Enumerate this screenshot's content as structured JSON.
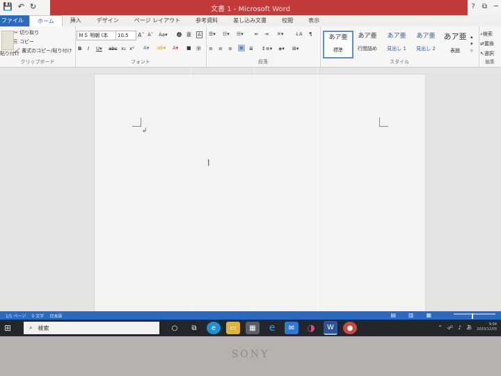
{
  "window": {
    "title": "文書 1 - Microsoft Word",
    "help": "?",
    "controls": [
      "⧉",
      "─"
    ]
  },
  "quick_access": [
    "💾",
    "↶",
    "↻"
  ],
  "tabs": [
    {
      "label": "ファイル"
    },
    {
      "label": "ホーム"
    },
    {
      "label": "挿入"
    },
    {
      "label": "デザイン"
    },
    {
      "label": "ページ レイアウト"
    },
    {
      "label": "参考資料"
    },
    {
      "label": "差し込み文書"
    },
    {
      "label": "校閲"
    },
    {
      "label": "表示"
    }
  ],
  "ribbon": {
    "clipboard": {
      "paste": "貼り付け",
      "cut": "切り取り",
      "copy": "コピー",
      "format_painter": "書式のコピー/貼り付け",
      "label": "クリップボード"
    },
    "font": {
      "name": "ＭＳ 明朝 (本",
      "size": "10.5",
      "label": "フォント"
    },
    "paragraph": {
      "label": "段落"
    },
    "styles": {
      "items": [
        {
          "preview": "あア亜",
          "name": "標準"
        },
        {
          "preview": "あア亜",
          "name": "行間詰め"
        },
        {
          "preview": "あア亜",
          "name": "見出し 1"
        },
        {
          "preview": "あア亜",
          "name": "見出し 2"
        },
        {
          "preview": "あア亜",
          "name": "表題"
        }
      ],
      "label": "スタイル"
    },
    "editing": {
      "find": "検索",
      "replace": "置換",
      "select": "選択",
      "label": "編集"
    }
  },
  "status": {
    "page": "1/1 ページ",
    "words": "0 文字",
    "language": "日本語"
  },
  "taskbar": {
    "search_placeholder": "検索",
    "ime": "あ",
    "time": "9:04",
    "date": "2020/12/03"
  },
  "bezel": {
    "brand": "SONY"
  },
  "colors": {
    "accent": "#2b6ac1",
    "title_bar": "#c23a3a"
  }
}
